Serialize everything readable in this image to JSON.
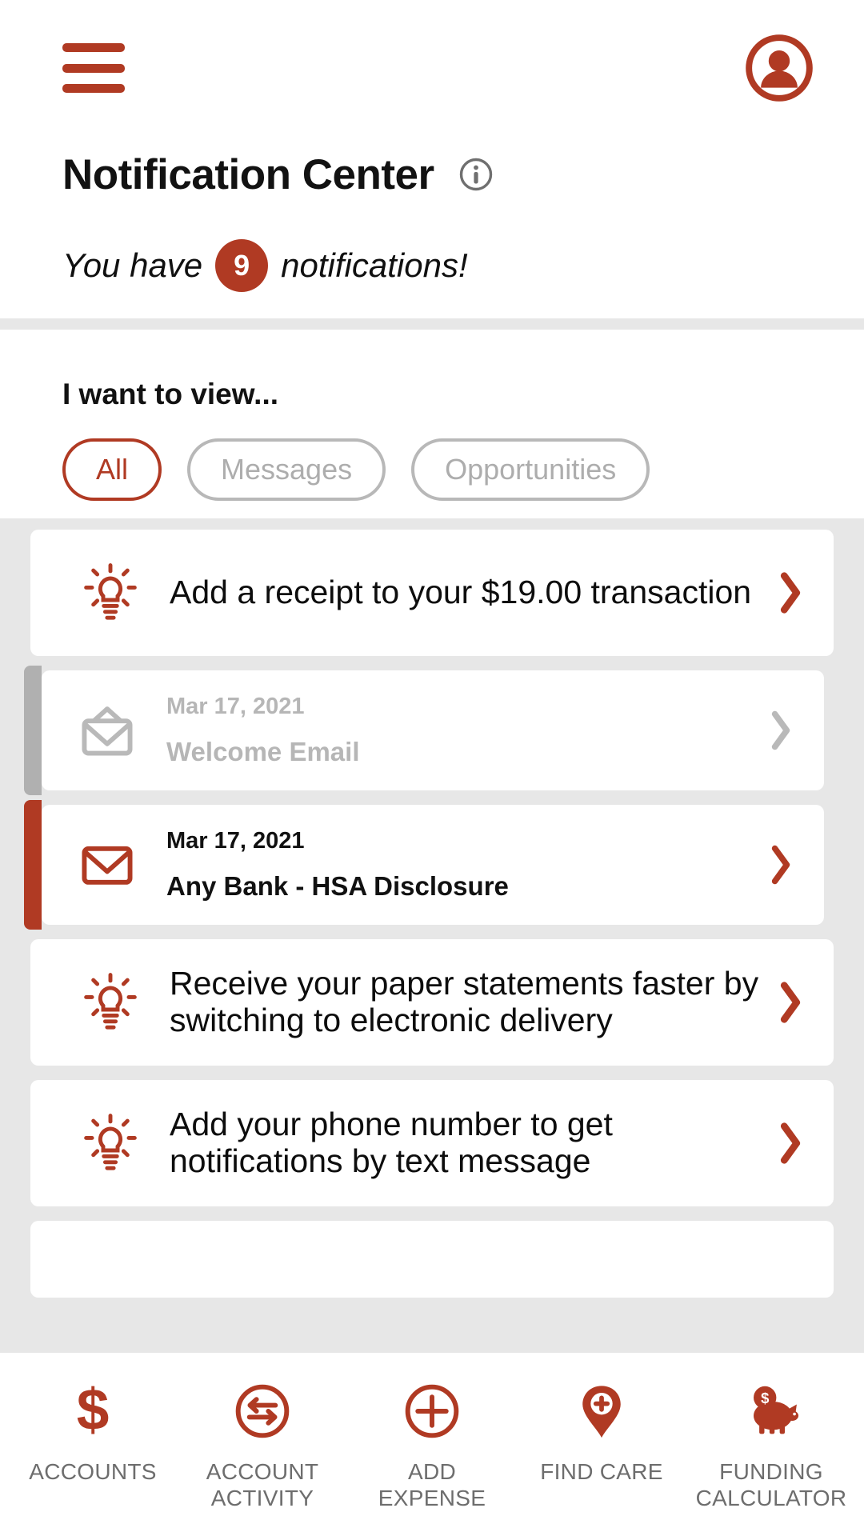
{
  "brand": {
    "red": "#b03a23",
    "gray": "#b0b0b0",
    "band": "#e7e7e7"
  },
  "topbar": {
    "menu_icon": "hamburger-menu-icon",
    "profile_icon": "user-avatar-icon"
  },
  "header": {
    "title": "Notification Center",
    "info_icon": "info-circle-icon",
    "subtitle_prefix": "You have",
    "notification_count": "9",
    "subtitle_suffix": "notifications!"
  },
  "filters": {
    "label": "I want to view...",
    "pills": [
      {
        "label": "All",
        "selected": true
      },
      {
        "label": "Messages",
        "selected": false
      },
      {
        "label": "Opportunities",
        "selected": false
      }
    ]
  },
  "notifications": [
    {
      "type": "opportunity",
      "icon": "lightbulb-icon",
      "text": "Add a receipt to your $19.00 transaction",
      "chevron": "chevron-right-icon"
    },
    {
      "type": "message",
      "state": "read",
      "icon": "envelope-open-icon",
      "date": "Mar 17, 2021",
      "subject": "Welcome Email",
      "chevron": "chevron-right-icon"
    },
    {
      "type": "message",
      "state": "unread",
      "icon": "envelope-closed-icon",
      "date": "Mar 17, 2021",
      "subject": "Any Bank - HSA Disclosure",
      "chevron": "chevron-right-icon"
    },
    {
      "type": "opportunity",
      "icon": "lightbulb-icon",
      "text": "Receive your paper statements faster by switching to electronic delivery",
      "chevron": "chevron-right-icon"
    },
    {
      "type": "opportunity",
      "icon": "lightbulb-icon",
      "text": "Add your phone number to get notifications by text message",
      "chevron": "chevron-right-icon"
    }
  ],
  "bottomnav": [
    {
      "icon": "dollar-sign-icon",
      "label": "ACCOUNTS"
    },
    {
      "icon": "transfer-arrows-icon",
      "label": "ACCOUNT\nACTIVITY"
    },
    {
      "icon": "plus-circle-icon",
      "label": "ADD\nEXPENSE"
    },
    {
      "icon": "map-pin-medical-icon",
      "label": "FIND CARE"
    },
    {
      "icon": "piggy-bank-icon",
      "label": "FUNDING\nCALCULATOR"
    }
  ]
}
